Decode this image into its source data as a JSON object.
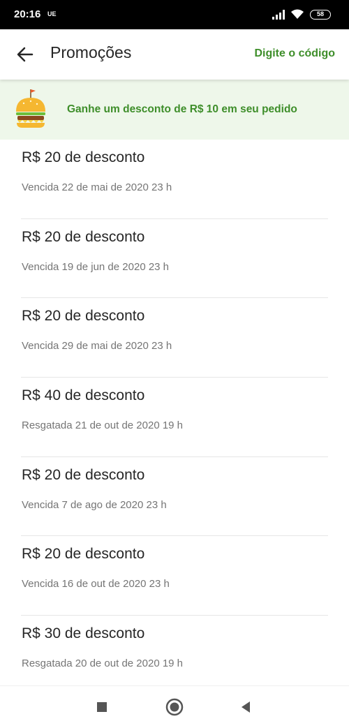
{
  "status_bar": {
    "time": "20:16",
    "carrier": "UE",
    "battery": "58"
  },
  "header": {
    "title": "Promoções",
    "code_link": "Digite o código"
  },
  "banner": {
    "text": "Ganhe um desconto de R$ 10 em seu pedido"
  },
  "promotions": [
    {
      "title": "R$ 20 de desconto",
      "status": "Vencida 22 de mai de 2020 23 h"
    },
    {
      "title": "R$ 20 de desconto",
      "status": "Vencida 19 de jun de 2020 23 h"
    },
    {
      "title": "R$ 20 de desconto",
      "status": "Vencida 29 de mai de 2020 23 h"
    },
    {
      "title": "R$ 40 de desconto",
      "status": "Resgatada 21 de out de 2020 19 h"
    },
    {
      "title": "R$ 20 de desconto",
      "status": "Vencida 7 de ago de 2020 23 h"
    },
    {
      "title": "R$ 20 de desconto",
      "status": "Vencida 16 de out de 2020 23 h"
    },
    {
      "title": "R$ 30 de desconto",
      "status": "Resgatada 20 de out de 2020 19 h"
    }
  ],
  "icons": {
    "back": "arrow-left-icon",
    "banner": "burger-icon",
    "nav_recent": "square-icon",
    "nav_home": "circle-icon",
    "nav_back": "triangle-back-icon"
  },
  "colors": {
    "accent": "#3e8e2a",
    "banner_bg": "#eef7ea",
    "title_text": "#262626",
    "secondary_text": "#757575"
  }
}
